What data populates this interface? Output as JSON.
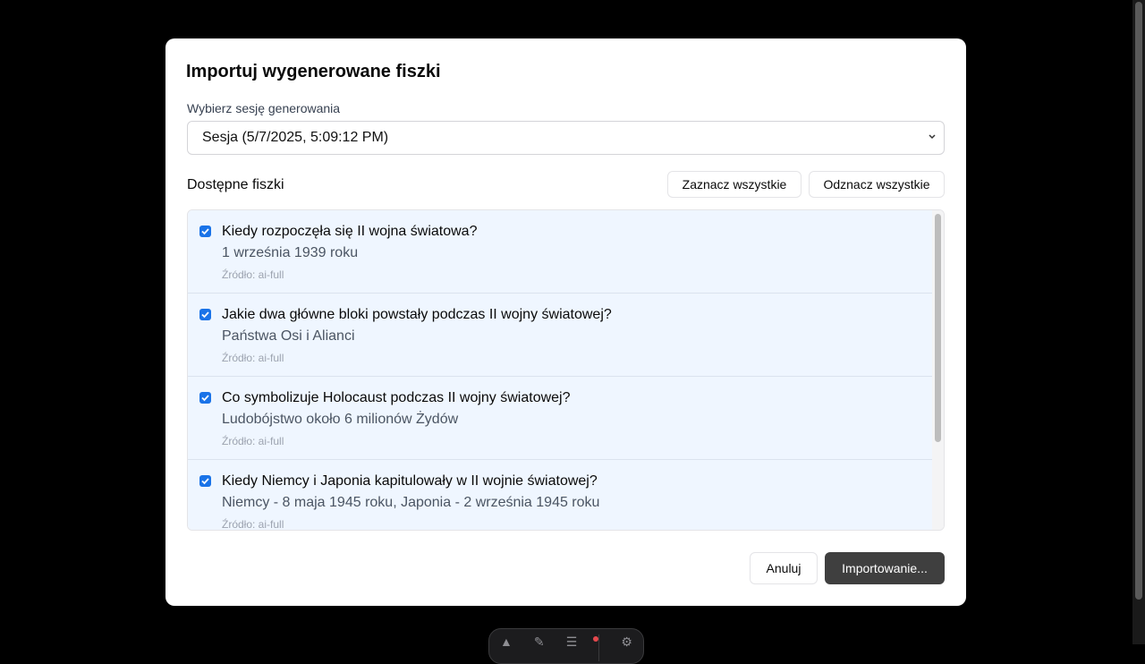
{
  "dialog": {
    "title": "Importuj wygenerowane fiszki",
    "session_label": "Wybierz sesję generowania",
    "session_selected": "Sesja (5/7/2025, 5:09:12 PM)",
    "section_title": "Dostępne fiszki",
    "select_all_label": "Zaznacz wszystkie",
    "deselect_all_label": "Odznacz wszystkie",
    "cancel_label": "Anuluj",
    "import_label": "Importowanie..."
  },
  "flashcards": [
    {
      "checked": true,
      "question": "Kiedy rozpoczęła się II wojna światowa?",
      "answer": "1 września 1939 roku",
      "source": "Źródło: ai-full"
    },
    {
      "checked": true,
      "question": "Jakie dwa główne bloki powstały podczas II wojny światowej?",
      "answer": "Państwa Osi i Alianci",
      "source": "Źródło: ai-full"
    },
    {
      "checked": true,
      "question": "Co symbolizuje Holocaust podczas II wojny światowej?",
      "answer": "Ludobójstwo około 6 milionów Żydów",
      "source": "Źródło: ai-full"
    },
    {
      "checked": true,
      "question": "Kiedy Niemcy i Japonia kapitulowały w II wojnie światowej?",
      "answer": "Niemcy - 8 maja 1945 roku, Japonia - 2 września 1945 roku",
      "source": "Źródło: ai-full"
    }
  ],
  "colors": {
    "accent_checkbox": "#1a73e8",
    "card_background": "#eff6ff",
    "primary_button": "#3f3f3f"
  },
  "icons": {
    "select_chevron": "chevron-down-icon",
    "checkbox_mark": "checkmark-icon"
  }
}
